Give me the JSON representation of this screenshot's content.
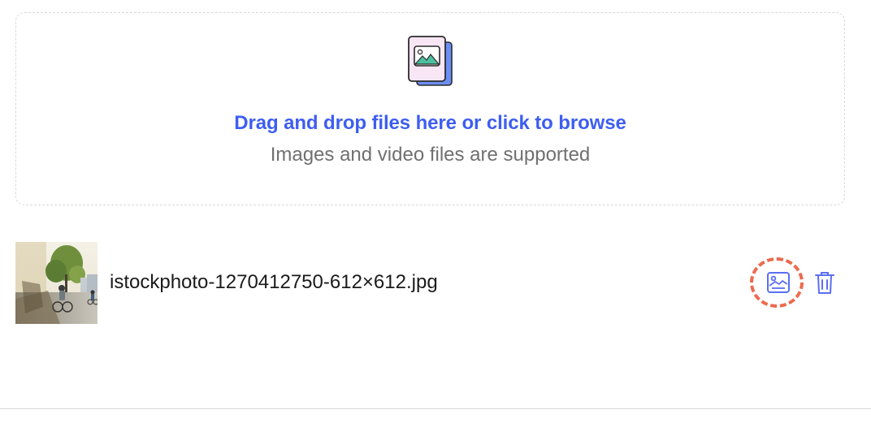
{
  "upload": {
    "title": "Drag and drop files here or click to browse",
    "subtitle": "Images and video files are supported",
    "icon": "image-stack-icon"
  },
  "files": [
    {
      "name": "istockphoto-1270412750-612×612.jpg",
      "thumbnail": "cyclist-street-photo",
      "actions": {
        "image_icon": "image-edit-icon",
        "delete_icon": "trash-icon"
      }
    }
  ],
  "colors": {
    "link": "#3d5ef0",
    "subtitle": "#707070",
    "highlight": "#ec6a4e",
    "action": "#5b6ff2"
  }
}
